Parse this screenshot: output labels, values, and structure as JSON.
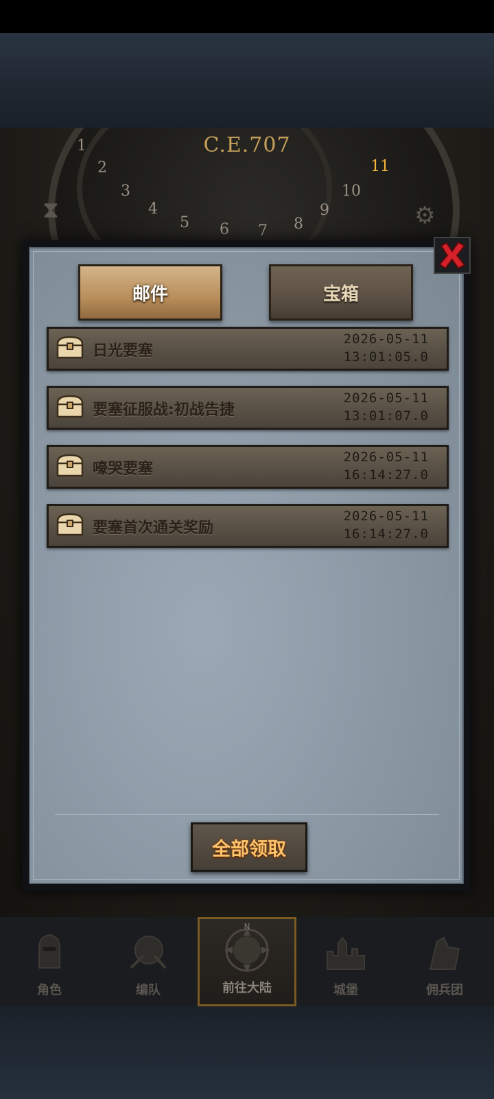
{
  "game_header": {
    "era_label": "C.E.707"
  },
  "dial_numbers": [
    "1",
    "2",
    "3",
    "4",
    "5",
    "6",
    "7",
    "8",
    "9",
    "10",
    "11"
  ],
  "dialog": {
    "tabs": [
      {
        "label": "邮件",
        "active": true
      },
      {
        "label": "宝箱",
        "active": false
      }
    ],
    "close_icon": "red-x-icon",
    "mails": [
      {
        "subject": "日光要塞",
        "date": "2026-05-11",
        "time": "13:01:05.0",
        "icon": "treasure-chest-icon"
      },
      {
        "subject": "要塞征服战:初战告捷",
        "date": "2026-05-11",
        "time": "13:01:07.0",
        "icon": "treasure-chest-icon"
      },
      {
        "subject": "嚎哭要塞",
        "date": "2026-05-11",
        "time": "16:14:27.0",
        "icon": "treasure-chest-icon"
      },
      {
        "subject": "要塞首次通关奖励",
        "date": "2026-05-11",
        "time": "16:14:27.0",
        "icon": "treasure-chest-icon"
      }
    ],
    "claim_all_label": "全部领取"
  },
  "bottom_nav": {
    "items": [
      {
        "label": "角色",
        "icon": "knight-helmet-icon",
        "active": false
      },
      {
        "label": "编队",
        "icon": "formation-icon",
        "active": false
      },
      {
        "label": "前往大陆",
        "icon": "compass-globe-icon",
        "active": true
      },
      {
        "label": "城堡",
        "icon": "castle-icon",
        "active": false
      },
      {
        "label": "佣兵团",
        "icon": "mercenary-icon",
        "active": false
      }
    ],
    "compass_n": "N"
  },
  "colors": {
    "accent_gold": "#ffc46b",
    "close_red": "#d6212a",
    "dialog_bg": "#8a97a3"
  }
}
